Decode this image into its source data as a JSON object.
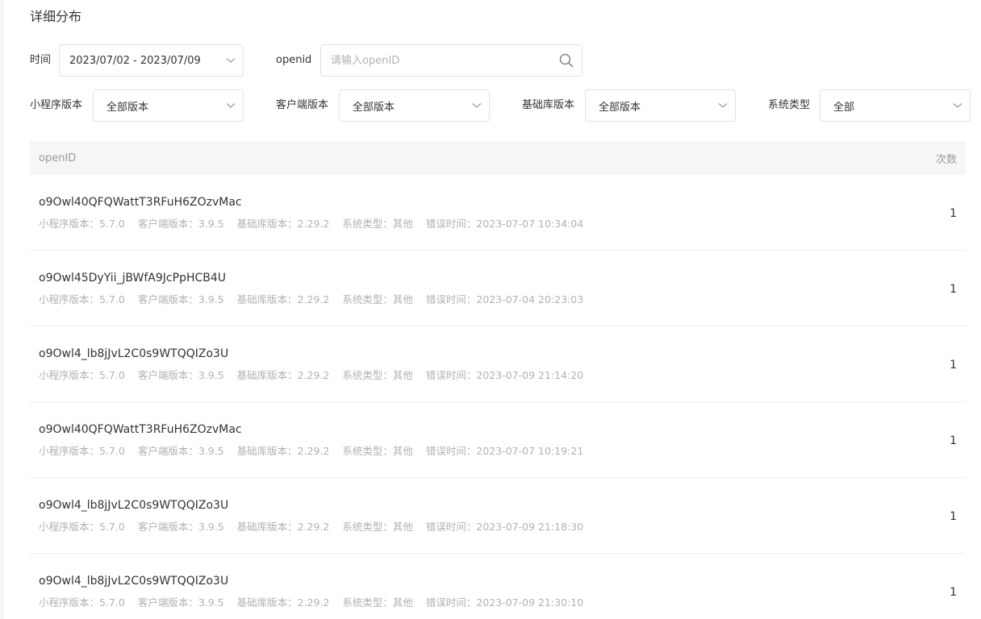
{
  "section": {
    "title": "详细分布"
  },
  "filters": {
    "time_label": "时间",
    "time_value": "2023/07/02 - 2023/07/09",
    "openid_label": "openid",
    "openid_placeholder": "请输入openID",
    "openid_value": "",
    "mini_version_label": "小程序版本",
    "mini_version_value": "全部版本",
    "client_version_label": "客户端版本",
    "client_version_value": "全部版本",
    "base_version_label": "基础库版本",
    "base_version_value": "全部版本",
    "os_label": "系统类型",
    "os_value": "全部"
  },
  "table": {
    "col_openid": "openID",
    "col_count": "次数",
    "rows": [
      {
        "openid": "o9Owl40QFQWattT3RFuH6ZOzvMac",
        "mini": "小程序版本：5.7.0",
        "client": "客户端版本：3.9.5",
        "base": "基础库版本：2.29.2",
        "os": "系统类型：其他",
        "time": "错误时间：2023-07-07 10:34:04",
        "count": "1"
      },
      {
        "openid": "o9Owl45DyYii_jBWfA9JcPpHCB4U",
        "mini": "小程序版本：5.7.0",
        "client": "客户端版本：3.9.5",
        "base": "基础库版本：2.29.2",
        "os": "系统类型：其他",
        "time": "错误时间：2023-07-04 20:23:03",
        "count": "1"
      },
      {
        "openid": "o9Owl4_lb8jJvL2C0s9WTQQIZo3U",
        "mini": "小程序版本：5.7.0",
        "client": "客户端版本：3.9.5",
        "base": "基础库版本：2.29.2",
        "os": "系统类型：其他",
        "time": "错误时间：2023-07-09 21:14:20",
        "count": "1"
      },
      {
        "openid": "o9Owl40QFQWattT3RFuH6ZOzvMac",
        "mini": "小程序版本：5.7.0",
        "client": "客户端版本：3.9.5",
        "base": "基础库版本：2.29.2",
        "os": "系统类型：其他",
        "time": "错误时间：2023-07-07 10:19:21",
        "count": "1"
      },
      {
        "openid": "o9Owl4_lb8jJvL2C0s9WTQQIZo3U",
        "mini": "小程序版本：5.7.0",
        "client": "客户端版本：3.9.5",
        "base": "基础库版本：2.29.2",
        "os": "系统类型：其他",
        "time": "错误时间：2023-07-09 21:18:30",
        "count": "1"
      },
      {
        "openid": "o9Owl4_lb8jJvL2C0s9WTQQIZo3U",
        "mini": "小程序版本：5.7.0",
        "client": "客户端版本：3.9.5",
        "base": "基础库版本：2.29.2",
        "os": "系统类型：其他",
        "time": "错误时间：2023-07-09 21:30:10",
        "count": "1"
      }
    ]
  }
}
